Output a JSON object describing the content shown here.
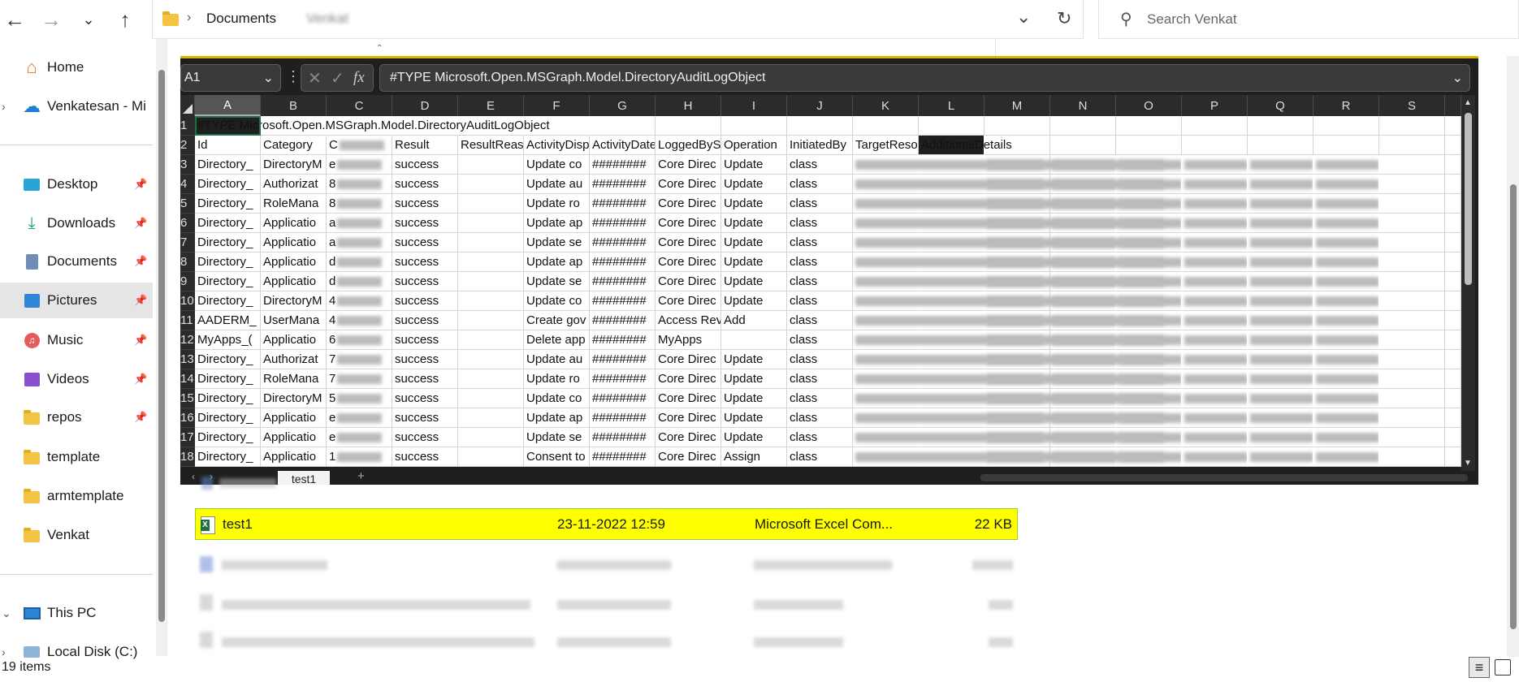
{
  "explorer": {
    "nav": {
      "back_icon": "arrow-left-icon",
      "forward_icon": "arrow-right-icon",
      "recent_icon": "chevron-down-icon",
      "up_icon": "arrow-up-icon"
    },
    "address": {
      "segments": [
        "Documents",
        "Venkat"
      ]
    },
    "search": {
      "placeholder": "Search Venkat"
    },
    "sidebar": {
      "items": [
        {
          "label": "Home",
          "icon": "home-icon"
        },
        {
          "label": "Venkatesan - Mi",
          "icon": "onedrive-cloud-icon"
        },
        {
          "label": "Desktop",
          "icon": "desktop-icon",
          "pinned": true
        },
        {
          "label": "Downloads",
          "icon": "download-icon",
          "pinned": true
        },
        {
          "label": "Documents",
          "icon": "documents-icon",
          "pinned": true
        },
        {
          "label": "Pictures",
          "icon": "pictures-icon",
          "pinned": true,
          "selected": true
        },
        {
          "label": "Music",
          "icon": "music-icon",
          "pinned": true
        },
        {
          "label": "Videos",
          "icon": "videos-icon",
          "pinned": true
        },
        {
          "label": "repos",
          "icon": "folder-icon",
          "pinned": true
        },
        {
          "label": "template",
          "icon": "folder-icon"
        },
        {
          "label": "armtemplate",
          "icon": "folder-icon"
        },
        {
          "label": "Venkat",
          "icon": "folder-icon"
        },
        {
          "label": "This PC",
          "icon": "computer-icon"
        },
        {
          "label": "Local Disk (C:)",
          "icon": "disk-icon"
        }
      ]
    },
    "files": {
      "selected": {
        "name": "test1",
        "date": "23-11-2022 12:59",
        "type": "Microsoft Excel Com...",
        "size": "22 KB",
        "highlight": "#ffff00"
      }
    },
    "status": {
      "count": "19 items"
    }
  },
  "excel": {
    "name_box": "A1",
    "formula": "#TYPE Microsoft.Open.MSGraph.Model.DirectoryAuditLogObject",
    "fx_label": "fx",
    "sheet_tab": "test1",
    "columns": [
      "A",
      "B",
      "C",
      "D",
      "E",
      "F",
      "G",
      "H",
      "I",
      "J",
      "K",
      "L",
      "M",
      "N",
      "O",
      "P",
      "Q",
      "R",
      "S"
    ],
    "rows": [
      {
        "n": "1",
        "cells": [
          "#TYPE Microsoft.Open.MSGraph.Model.DirectoryAuditLogObject",
          "",
          "",
          "",
          "",
          "",
          "",
          "",
          "",
          "",
          "",
          "",
          ""
        ]
      },
      {
        "n": "2",
        "cells": [
          "Id",
          "Category",
          "C",
          "Result",
          "ResultReason",
          "ActivityDisplayName",
          "ActivityDateTime",
          "LoggedByService",
          "Operation",
          "InitiatedBy",
          "TargetResources",
          "AdditionalDetails",
          ""
        ]
      },
      {
        "n": "3",
        "cells": [
          "Directory_",
          "DirectoryM",
          "e",
          "success",
          "",
          "Update co",
          "########",
          "Core Direc",
          "Update",
          "class",
          "",
          "",
          ""
        ]
      },
      {
        "n": "4",
        "cells": [
          "Directory_",
          "Authorizat",
          "8",
          "success",
          "",
          "Update au",
          "########",
          "Core Direc",
          "Update",
          "class",
          "",
          "",
          ""
        ]
      },
      {
        "n": "5",
        "cells": [
          "Directory_",
          "RoleMana",
          "8",
          "success",
          "",
          "Update ro",
          "########",
          "Core Direc",
          "Update",
          "class",
          "",
          "",
          ""
        ]
      },
      {
        "n": "6",
        "cells": [
          "Directory_",
          "Applicatio",
          "a",
          "success",
          "",
          "Update ap",
          "########",
          "Core Direc",
          "Update",
          "class",
          "",
          "",
          ""
        ]
      },
      {
        "n": "7",
        "cells": [
          "Directory_",
          "Applicatio",
          "a",
          "success",
          "",
          "Update se",
          "########",
          "Core Direc",
          "Update",
          "class",
          "",
          "",
          ""
        ]
      },
      {
        "n": "8",
        "cells": [
          "Directory_",
          "Applicatio",
          "d",
          "success",
          "",
          "Update ap",
          "########",
          "Core Direc",
          "Update",
          "class",
          "",
          "",
          ""
        ]
      },
      {
        "n": "9",
        "cells": [
          "Directory_",
          "Applicatio",
          "d",
          "success",
          "",
          "Update se",
          "########",
          "Core Direc",
          "Update",
          "class",
          "",
          "",
          ""
        ]
      },
      {
        "n": "10",
        "cells": [
          "Directory_",
          "DirectoryM",
          "4",
          "success",
          "",
          "Update co",
          "########",
          "Core Direc",
          "Update",
          "class",
          "",
          "",
          ""
        ]
      },
      {
        "n": "11",
        "cells": [
          "AADERM_",
          "UserMana",
          "4",
          "success",
          "",
          "Create gov",
          "########",
          "Access Rev",
          "Add",
          "class",
          "",
          "",
          ""
        ]
      },
      {
        "n": "12",
        "cells": [
          "MyApps_(",
          "Applicatio",
          "6",
          "success",
          "",
          "Delete app",
          "########",
          "MyApps",
          "",
          "class",
          "",
          "",
          ""
        ]
      },
      {
        "n": "13",
        "cells": [
          "Directory_",
          "Authorizat",
          "7",
          "success",
          "",
          "Update au",
          "########",
          "Core Direc",
          "Update",
          "class",
          "",
          "",
          ""
        ]
      },
      {
        "n": "14",
        "cells": [
          "Directory_",
          "RoleMana",
          "7",
          "success",
          "",
          "Update ro",
          "########",
          "Core Direc",
          "Update",
          "class",
          "",
          "",
          ""
        ]
      },
      {
        "n": "15",
        "cells": [
          "Directory_",
          "DirectoryM",
          "5",
          "success",
          "",
          "Update co",
          "########",
          "Core Direc",
          "Update",
          "class",
          "",
          "",
          ""
        ]
      },
      {
        "n": "16",
        "cells": [
          "Directory_",
          "Applicatio",
          "e",
          "success",
          "",
          "Update ap",
          "########",
          "Core Direc",
          "Update",
          "class",
          "",
          "",
          ""
        ]
      },
      {
        "n": "17",
        "cells": [
          "Directory_",
          "Applicatio",
          "e",
          "success",
          "",
          "Update se",
          "########",
          "Core Direc",
          "Update",
          "class",
          "",
          "",
          ""
        ]
      },
      {
        "n": "18",
        "cells": [
          "Directory_",
          "Applicatio",
          "1",
          "success",
          "",
          "Consent to",
          "########",
          "Core Direc",
          "Assign",
          "class",
          "",
          "",
          ""
        ]
      }
    ],
    "theme": {
      "chrome": "#1f1f1f",
      "header": "#2b2b2b",
      "selection": "#1e7145"
    }
  }
}
